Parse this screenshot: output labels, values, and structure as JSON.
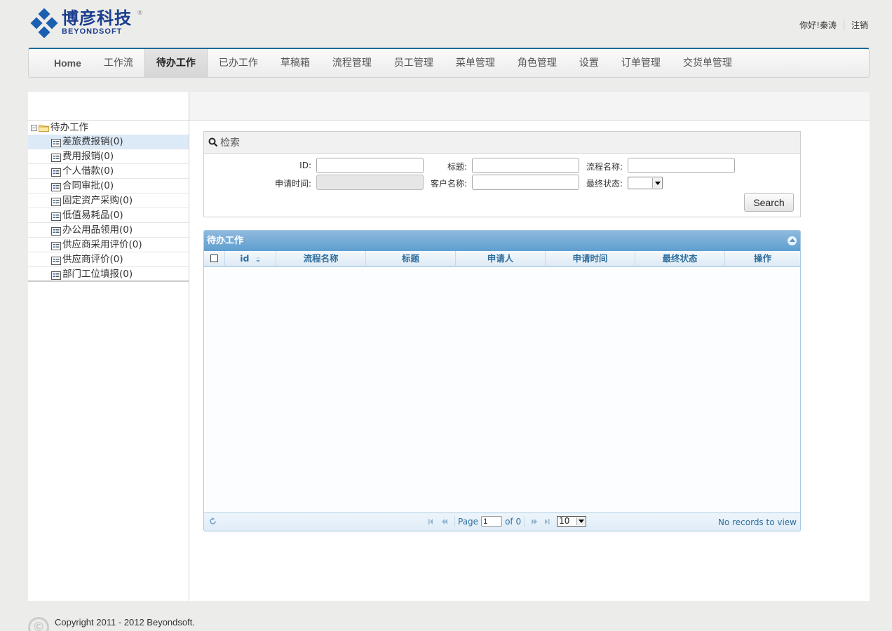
{
  "header": {
    "logo_cn": "博彦科技",
    "logo_en": "BEYONDSOFT",
    "greeting": "你好!秦涛",
    "logout": "注销"
  },
  "nav": {
    "items": [
      "Home",
      "工作流",
      "待办工作",
      "已办工作",
      "草稿箱",
      "流程管理",
      "员工管理",
      "菜单管理",
      "角色管理",
      "设置",
      "订单管理",
      "交货单管理"
    ],
    "active": "待办工作"
  },
  "tree": {
    "root": "待办工作",
    "items": [
      "差旅费报销(0)",
      "费用报销(0)",
      "个人借款(0)",
      "合同审批(0)",
      "固定资产采购(0)",
      "低值易耗品(0)",
      "办公用品领用(0)",
      "供应商采用评价(0)",
      "供应商评价(0)",
      "部门工位填报(0)"
    ],
    "selected_index": 0
  },
  "search": {
    "title": "检索",
    "labels": {
      "id": "ID:",
      "title": "标题:",
      "process_name": "流程名称:",
      "apply_time": "申请时间:",
      "customer_name": "客户名称:",
      "final_status": "最终状态:"
    },
    "values": {
      "id": "",
      "title": "",
      "process_name": "",
      "apply_time": "",
      "customer_name": "",
      "final_status": ""
    },
    "button": "Search"
  },
  "grid": {
    "caption": "待办工作",
    "columns": [
      "id",
      "流程名称",
      "标题",
      "申请人",
      "申请时间",
      "最终状态",
      "操作"
    ],
    "rows": [],
    "pager": {
      "page_label": "Page",
      "page_value": "1",
      "of_label": "of 0",
      "rows_per_page": "10",
      "records": "No records to view"
    }
  },
  "footer": {
    "copyright": "Copyright 2011 - 2012 Beyondsoft."
  },
  "colors": {
    "brand_blue": "#1b3e8e",
    "nav_accent": "#1a6b9a",
    "grid_header_text": "#2e6e9e",
    "selected_bg": "#dce9f7"
  }
}
